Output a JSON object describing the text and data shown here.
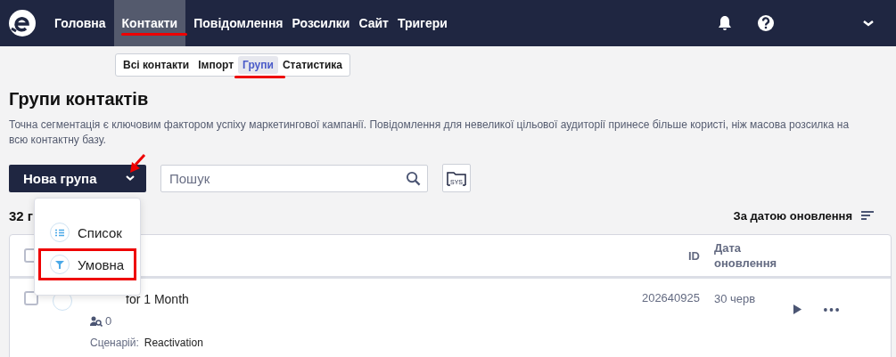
{
  "top_nav": {
    "items": [
      {
        "label": "Головна",
        "selected": false,
        "annotated": false
      },
      {
        "label": "Контакти",
        "selected": true,
        "annotated": true
      },
      {
        "label": "Повідомлення",
        "selected": false,
        "annotated": false
      },
      {
        "label": "Розсилки",
        "selected": false,
        "annotated": false
      },
      {
        "label": "Сайт",
        "selected": false,
        "annotated": false
      },
      {
        "label": "Тригери",
        "selected": false,
        "annotated": false
      }
    ]
  },
  "subtabs": [
    {
      "label": "Всі контакти",
      "selected": false,
      "annotated": false
    },
    {
      "label": "Імпорт",
      "selected": false,
      "annotated": false
    },
    {
      "label": "Групи",
      "selected": true,
      "annotated": true
    },
    {
      "label": "Статистика",
      "selected": false,
      "annotated": false
    }
  ],
  "title": "Групи контактів",
  "description": "Точна сегментація є ключовим фактором успіху маркетингової кампанії. Повідомлення для невеликої цільової аудиторії принесе більше користі, ніж масова розсилка на всю контактну базу.",
  "new_group_button": {
    "label": "Нова група",
    "annotated_arrow": true
  },
  "search": {
    "placeholder": "Пошук"
  },
  "sys_folder": {
    "label": "SYS"
  },
  "count": "32 г",
  "sort": {
    "label": "За датою оновлення"
  },
  "table": {
    "header_checked": false,
    "columns": [
      "ID",
      "Дата оновлення"
    ],
    "rows": [
      {
        "checked": false,
        "name": "for 1 Month",
        "contacts": "0",
        "scenario_label": "Сценарій:",
        "scenario": "Reactivation",
        "id": "202640925",
        "date": "30 черв"
      }
    ]
  },
  "menu": {
    "items": [
      {
        "kind": "list",
        "label": "Список",
        "annotated": false
      },
      {
        "kind": "conditional",
        "label": "Умовна",
        "annotated": true
      }
    ]
  }
}
